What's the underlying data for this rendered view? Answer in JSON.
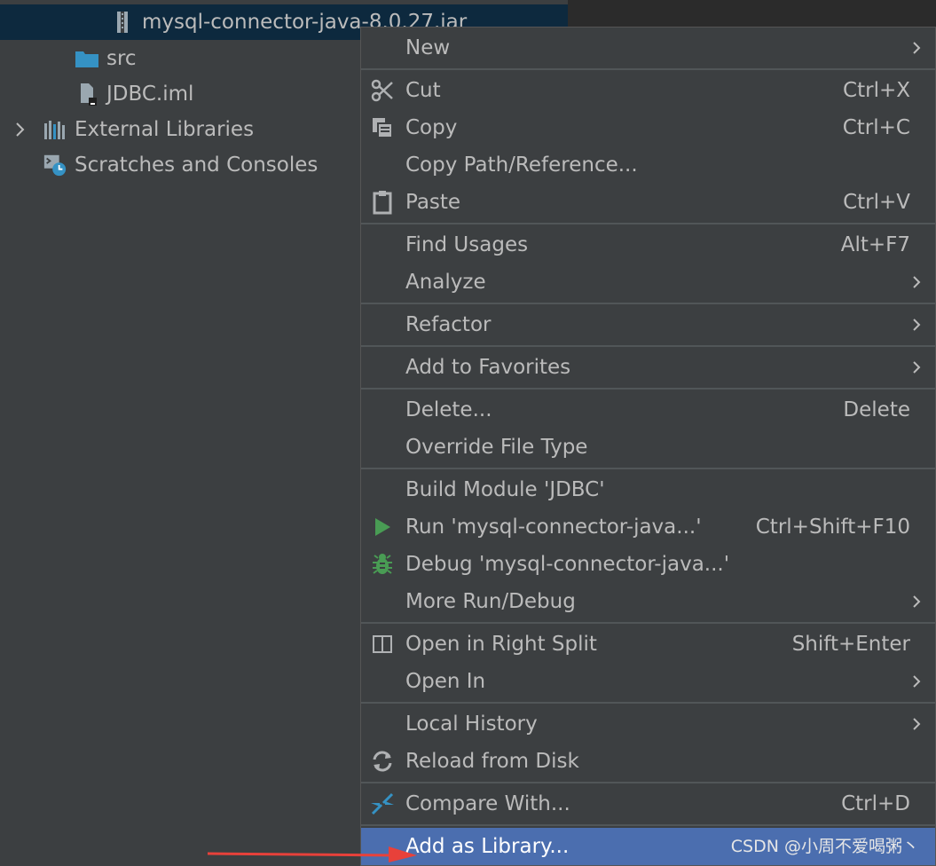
{
  "tree": {
    "items": [
      {
        "label": "mysql-connector-java-8.0.27.jar",
        "icon": "jar-archive-icon",
        "selected": true
      },
      {
        "label": "src",
        "icon": "folder-icon"
      },
      {
        "label": "JDBC.iml",
        "icon": "module-file-icon"
      },
      {
        "label": "External Libraries",
        "icon": "libraries-icon",
        "expandable": true
      },
      {
        "label": "Scratches and Consoles",
        "icon": "scratches-icon"
      }
    ]
  },
  "menu": {
    "items": [
      {
        "label": "New",
        "submenu": true
      },
      {
        "label": "Cut",
        "shortcut": "Ctrl+X",
        "icon": "scissors-icon"
      },
      {
        "label": "Copy",
        "shortcut": "Ctrl+C",
        "icon": "copy-icon"
      },
      {
        "label": "Copy Path/Reference..."
      },
      {
        "label": "Paste",
        "shortcut": "Ctrl+V",
        "icon": "clipboard-icon"
      },
      {
        "label": "Find Usages",
        "shortcut": "Alt+F7"
      },
      {
        "label": "Analyze",
        "submenu": true
      },
      {
        "label": "Refactor",
        "submenu": true
      },
      {
        "label": "Add to Favorites",
        "submenu": true
      },
      {
        "label": "Delete...",
        "shortcut": "Delete"
      },
      {
        "label": "Override File Type"
      },
      {
        "label": "Build Module 'JDBC'"
      },
      {
        "label": "Run 'mysql-connector-java...'",
        "shortcut": "Ctrl+Shift+F10",
        "icon": "run-icon"
      },
      {
        "label": "Debug 'mysql-connector-java...'",
        "icon": "debug-icon"
      },
      {
        "label": "More Run/Debug",
        "submenu": true
      },
      {
        "label": "Open in Right Split",
        "shortcut": "Shift+Enter",
        "icon": "split-icon"
      },
      {
        "label": "Open In",
        "submenu": true
      },
      {
        "label": "Local History",
        "submenu": true
      },
      {
        "label": "Reload from Disk",
        "icon": "reload-icon"
      },
      {
        "label": "Compare With...",
        "shortcut": "Ctrl+D",
        "icon": "compare-icon"
      },
      {
        "label": "Add as Library...",
        "highlighted": true
      }
    ]
  },
  "watermark": "CSDN @小周不爱喝粥丶",
  "colors": {
    "menu_bg": "#3c3f41",
    "highlight": "#4b6eaf",
    "tree_selected": "#0d293e",
    "run_green": "#499c54",
    "accent_blue": "#3592c4",
    "arrow_red": "#e8413a"
  }
}
